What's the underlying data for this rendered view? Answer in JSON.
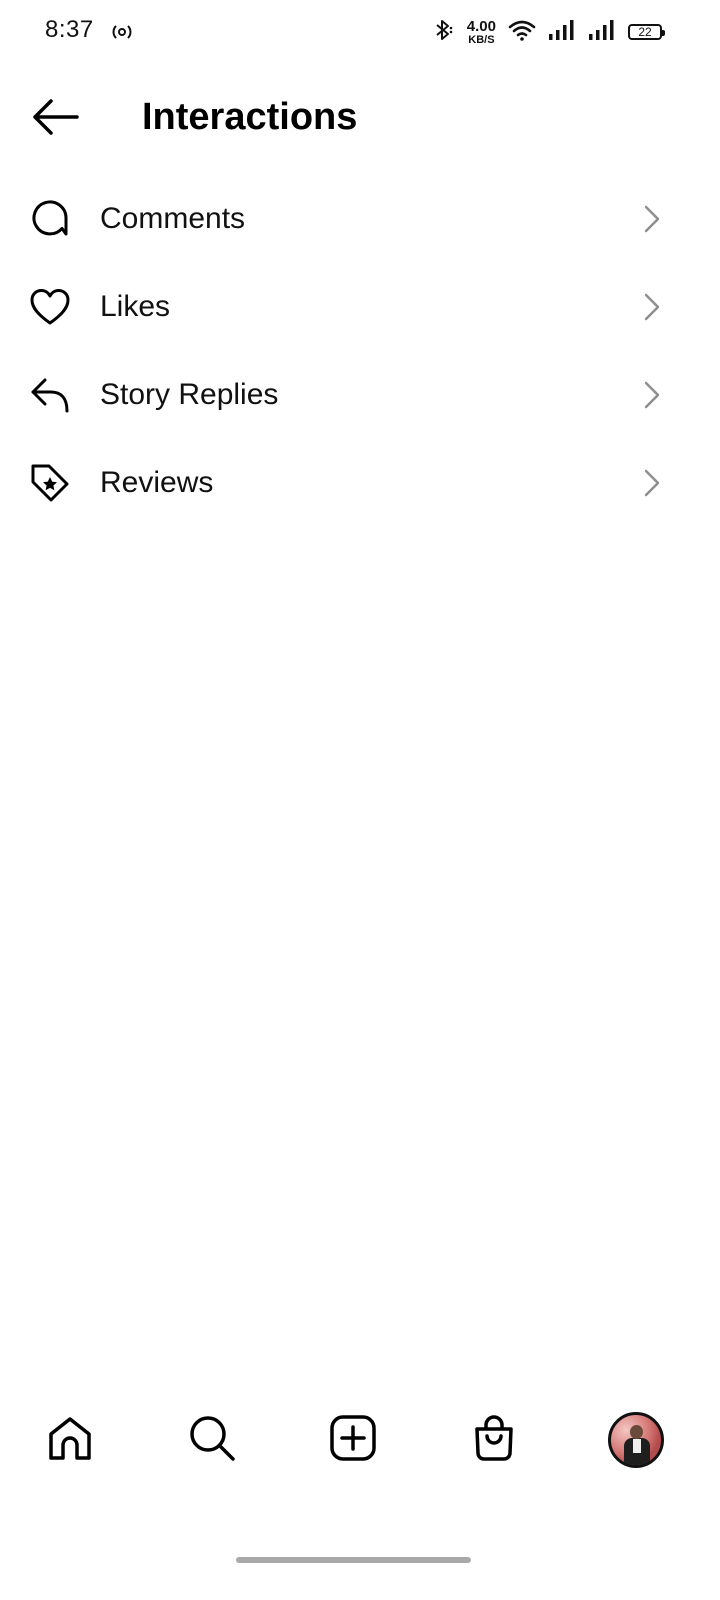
{
  "status_bar": {
    "time": "8:37",
    "net_speed_value": "4.00",
    "net_speed_unit": "KB/S",
    "battery_level": "22",
    "icons": [
      "hotspot-icon",
      "bluetooth-icon",
      "wifi-icon",
      "signal-icon",
      "signal-icon",
      "battery-icon"
    ]
  },
  "header": {
    "title": "Interactions",
    "back_icon": "arrow-left-icon"
  },
  "menu": {
    "items": [
      {
        "label": "Comments",
        "icon": "comment-icon"
      },
      {
        "label": "Likes",
        "icon": "heart-icon"
      },
      {
        "label": "Story Replies",
        "icon": "reply-icon"
      },
      {
        "label": "Reviews",
        "icon": "tag-star-icon"
      }
    ],
    "chevron_icon": "chevron-right-icon"
  },
  "bottom_nav": {
    "items": [
      "home-icon",
      "search-icon",
      "create-icon",
      "shop-icon",
      "profile-avatar"
    ]
  },
  "colors": {
    "background": "#ffffff",
    "text": "#000000",
    "chevron": "#8e8e8e",
    "home_indicator": "#a9a9a9"
  }
}
